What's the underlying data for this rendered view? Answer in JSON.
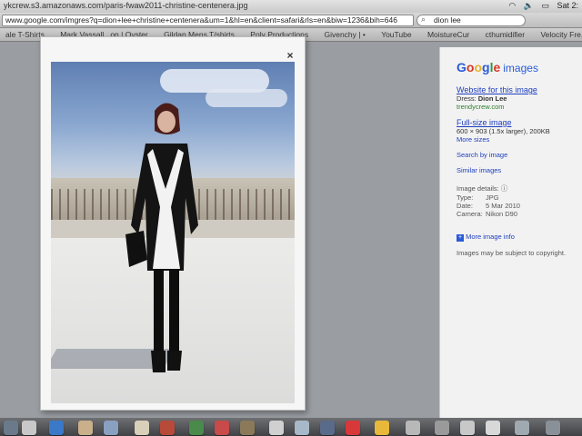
{
  "browser": {
    "menubar_url_fragment": "w.google.com/imgres?q=dion+lee+christine+centenera&um=1&hl=en&client=safari&rls=en&biw=1236&bih=646",
    "title_fragment": "ykcrew.s3.amazonaws.com/paris-fwaw2011-christine-centenera.jpg",
    "clock": "Sat 2:",
    "url": "www.google.com/imgres?q=dion+lee+christine+centenera&um=1&hl=en&client=safari&rls=en&biw=1236&bih=646",
    "search_query": "dion lee",
    "bookmarks": [
      "ale T-Shirts",
      "Mark Vassall...on | Oyster",
      "Gildan Mens T/shirts",
      "Poly Productions",
      "Givenchy | •",
      "YouTube",
      "MoistureCur",
      "cthumidifier",
      "Velocity Fre...in Australia"
    ]
  },
  "lightbox": {
    "close_label": "×"
  },
  "panel": {
    "logo_google": [
      "G",
      "o",
      "o",
      "g",
      "l",
      "e"
    ],
    "logo_images": "images",
    "website_link": "Website for this image",
    "dress_label": "Dress:",
    "dress_value": "Dion Lee",
    "site": "trendycrew.com",
    "fullsize_link": "Full-size image",
    "fullsize_info": "600 × 903 (1.5x larger), 200KB",
    "more_sizes": "More sizes",
    "search_by_image": "Search by image",
    "similar_images": "Similar images",
    "details_heading": "Image details:",
    "type_label": "Type:",
    "type_value": "JPG",
    "date_label": "Date:",
    "date_value": "5 Mar 2010",
    "camera_label": "Camera:",
    "camera_value": "Nikon D90",
    "more_info": "More image info",
    "copyright": "Images may be subject to copyright."
  },
  "colors": {
    "link": "#1f3fbf",
    "green_url": "#2d7f2d",
    "panel_bg": "#f2f2f2"
  }
}
